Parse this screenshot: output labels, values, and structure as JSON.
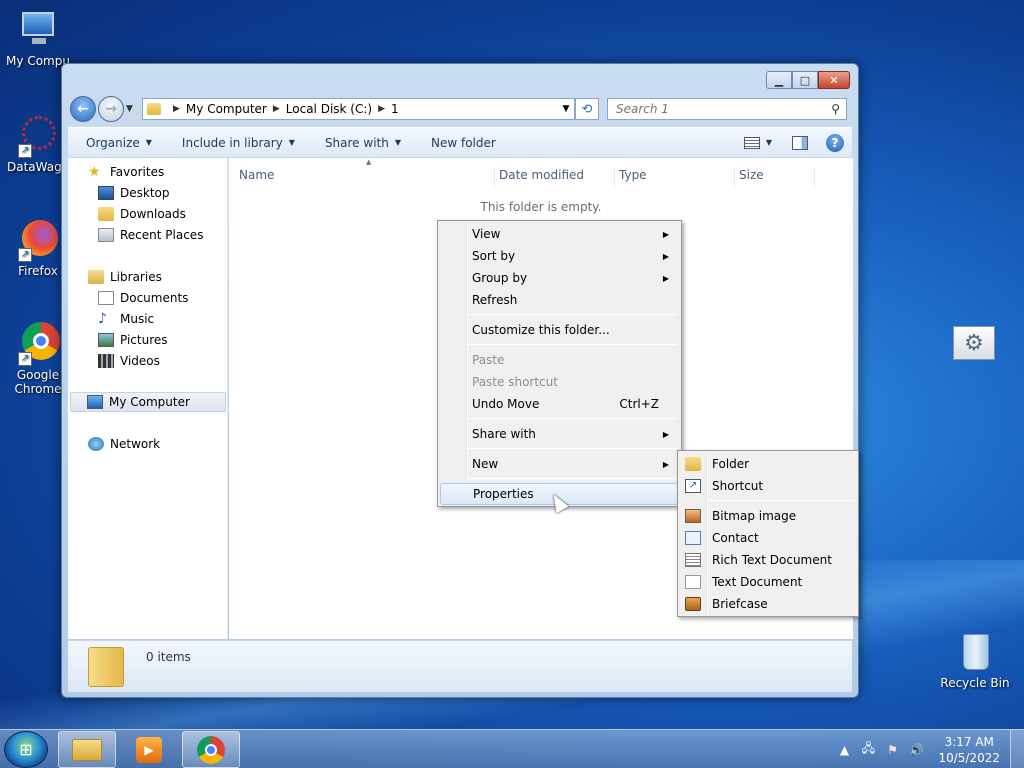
{
  "desktop": {
    "icons": [
      {
        "label": "My Compu"
      },
      {
        "label": "DataWago"
      },
      {
        "label": "Firefox"
      },
      {
        "label": "Google Chrome"
      },
      {
        "label": "Recycle Bin"
      }
    ]
  },
  "window": {
    "address": {
      "segments": [
        "My Computer",
        "Local Disk (C:)",
        "1"
      ]
    },
    "search": {
      "placeholder": "Search 1"
    },
    "toolbar": {
      "organize": "Organize",
      "include": "Include in library",
      "share": "Share with",
      "new_folder": "New folder"
    },
    "nav": {
      "favorites": "Favorites",
      "desktop": "Desktop",
      "downloads": "Downloads",
      "recent": "Recent Places",
      "libraries": "Libraries",
      "documents": "Documents",
      "music": "Music",
      "pictures": "Pictures",
      "videos": "Videos",
      "computer": "My Computer",
      "network": "Network"
    },
    "columns": {
      "name": "Name",
      "date": "Date modified",
      "type": "Type",
      "size": "Size"
    },
    "empty_text": "This folder is empty.",
    "details": {
      "count": "0 items"
    }
  },
  "context_menu": {
    "items": {
      "view": "View",
      "sort": "Sort by",
      "group": "Group by",
      "refresh": "Refresh",
      "customize": "Customize this folder...",
      "paste": "Paste",
      "paste_shortcut": "Paste shortcut",
      "undo": "Undo Move",
      "undo_shortcut": "Ctrl+Z",
      "share": "Share with",
      "new": "New",
      "properties": "Properties"
    }
  },
  "new_submenu": {
    "folder": "Folder",
    "shortcut": "Shortcut",
    "bitmap": "Bitmap image",
    "contact": "Contact",
    "rtf": "Rich Text Document",
    "text": "Text Document",
    "briefcase": "Briefcase"
  },
  "taskbar": {
    "time": "3:17 AM",
    "date": "10/5/2022"
  }
}
